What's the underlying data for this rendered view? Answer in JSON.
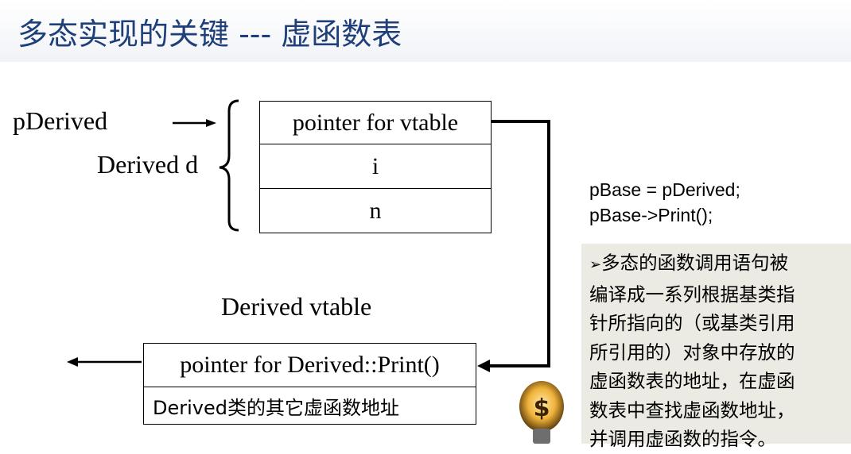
{
  "title": "多态实现的关键 --- 虚函数表",
  "labels": {
    "p_derived": "pDerived",
    "derived_d": "Derived d",
    "derived_vtable": "Derived vtable"
  },
  "object_cells": [
    "pointer for vtable",
    "i",
    "n"
  ],
  "vtable_cells": [
    "pointer for Derived::Print()",
    "Derived类的其它虚函数地址"
  ],
  "code": [
    "pBase = pDerived;",
    "pBase->Print();"
  ],
  "note": {
    "bullet": "➢",
    "lines": [
      "多态的函数调用语句被",
      "编译成一系列根据基类指",
      "针所指向的（或基类引用",
      "所引用的）对象中存放的",
      "虚函数表的地址，在虚函",
      "数表中查找虚函数地址，",
      "并调用虚函数的指令。"
    ]
  },
  "icon": "lightbulb-dollar-icon",
  "colors": {
    "title": "#1f3f7a",
    "note_bg": "#ecebe3",
    "bulb_glow": "#f0b33a"
  }
}
